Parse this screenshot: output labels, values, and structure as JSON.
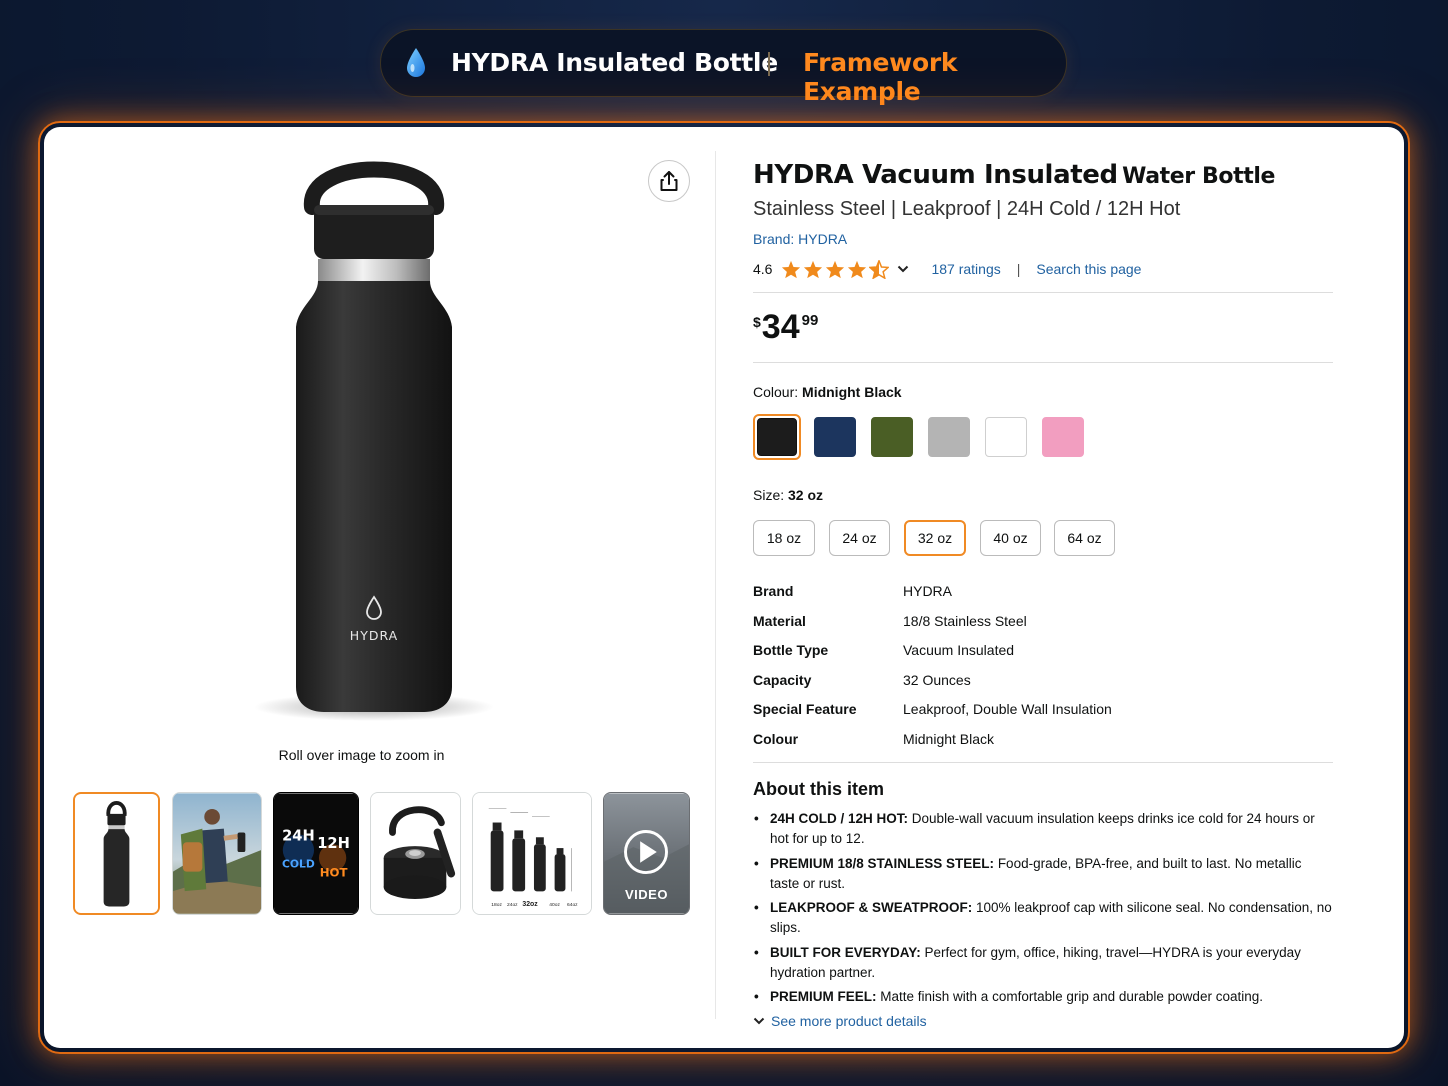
{
  "header": {
    "icon": "water-drop-icon",
    "title": "HYDRA Insulated Bottle",
    "subtitle": "Framework Example",
    "accent_color": "#ff8a1f"
  },
  "gallery": {
    "main_image_logo": "HYDRA",
    "zoom_hint": "Roll over image to zoom in",
    "thumbnails": [
      {
        "name": "thumb-bottle",
        "selected": true
      },
      {
        "name": "thumb-hiker"
      },
      {
        "name": "thumb-temperature",
        "line1": "24H",
        "line2": "COLD",
        "line3": "12H",
        "line4": "HOT"
      },
      {
        "name": "thumb-cap"
      },
      {
        "name": "thumb-sizes",
        "labels": [
          "18oz",
          "24oz",
          "32oz",
          "40oz",
          "64oz"
        ]
      },
      {
        "name": "thumb-video",
        "label": "VIDEO"
      }
    ]
  },
  "product": {
    "title_main": "HYDRA Vacuum Insulated",
    "title_tail": "Water Bottle",
    "subtitle": "Stainless Steel | Leakproof | 24H Cold / 12H Hot",
    "brand_link": "Brand: HYDRA",
    "rating": {
      "value": "4.6",
      "stars": 4.5,
      "ratings_link": "187 ratings",
      "search_link": "Search this page",
      "separator": "|"
    },
    "price": {
      "symbol": "$",
      "whole": "34",
      "fraction": "99"
    },
    "colour": {
      "label": "Colour:",
      "selected": "Midnight Black",
      "swatches": [
        {
          "name": "Midnight Black",
          "hex": "#1c1c1c"
        },
        {
          "name": "Navy",
          "hex": "#1c355e"
        },
        {
          "name": "Olive",
          "hex": "#4a5e25"
        },
        {
          "name": "Grey",
          "hex": "#b4b4b4"
        },
        {
          "name": "White",
          "hex": "#ffffff"
        },
        {
          "name": "Pink",
          "hex": "#f29ec0"
        }
      ]
    },
    "size": {
      "label": "Size:",
      "selected": "32 oz",
      "options": [
        "18 oz",
        "24 oz",
        "32 oz",
        "40 oz",
        "64 oz"
      ]
    },
    "specs": [
      {
        "key": "Brand",
        "value": "HYDRA"
      },
      {
        "key": "Material",
        "value": "18/8 Stainless Steel"
      },
      {
        "key": "Bottle Type",
        "value": "Vacuum Insulated"
      },
      {
        "key": "Capacity",
        "value": "32 Ounces"
      },
      {
        "key": "Special Feature",
        "value": "Leakproof, Double Wall Insulation"
      },
      {
        "key": "Colour",
        "value": "Midnight Black"
      }
    ],
    "about": {
      "title": "About this item",
      "bullets": [
        {
          "head": "24H COLD / 12H HOT:",
          "text": "Double-wall vacuum insulation keeps drinks ice cold for 24 hours or hot for up to 12."
        },
        {
          "head": "PREMIUM 18/8 STAINLESS STEEL:",
          "text": "Food-grade, BPA-free, and built to last. No metallic taste or rust."
        },
        {
          "head": "LEAKPROOF & SWEATPROOF:",
          "text": "100% leakproof cap with silicone seal. No condensation, no slips."
        },
        {
          "head": "BUILT FOR EVERYDAY:",
          "text": "Perfect for gym, office, hiking, travel—HYDRA is your everyday hydration partner."
        },
        {
          "head": "PREMIUM FEEL:",
          "text": "Matte finish with a comfortable grip and durable powder coating."
        }
      ],
      "see_more": "See more product details"
    }
  }
}
